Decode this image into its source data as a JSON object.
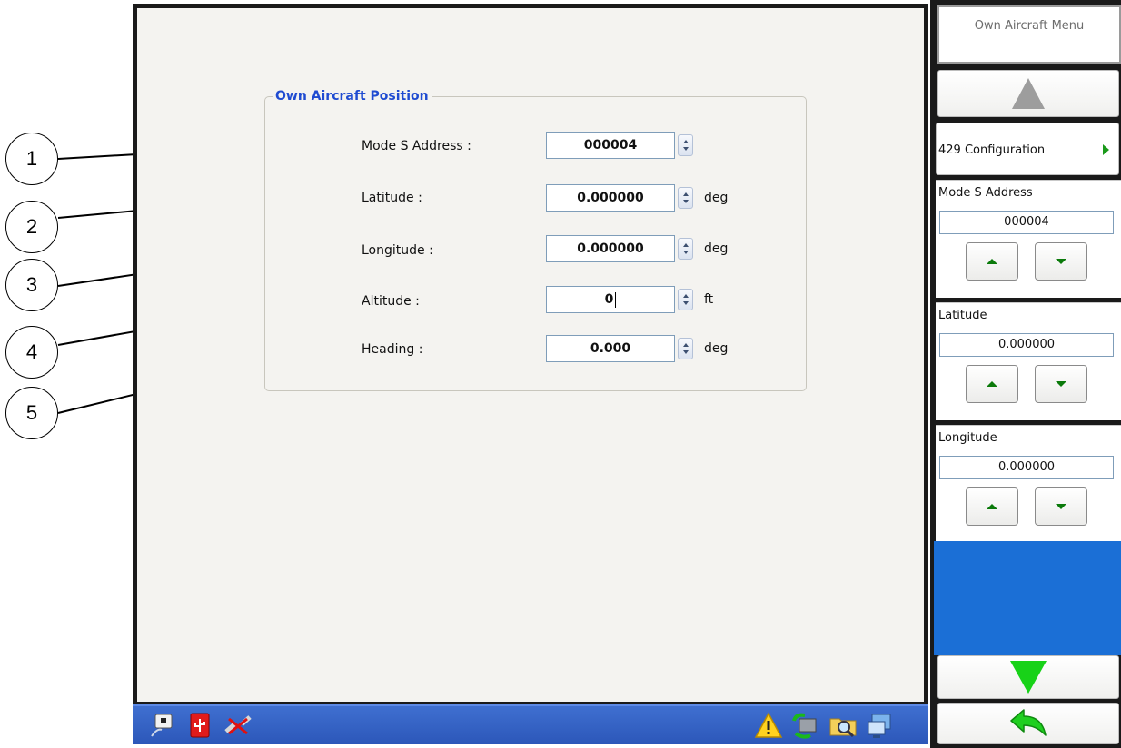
{
  "callouts": [
    "1",
    "2",
    "3",
    "4",
    "5"
  ],
  "group": {
    "title": "Own Aircraft Position"
  },
  "fields": [
    {
      "label": "Mode S Address :",
      "value": "000004",
      "unit": ""
    },
    {
      "label": "Latitude :",
      "value": "0.000000",
      "unit": "deg"
    },
    {
      "label": "Longitude :",
      "value": "0.000000",
      "unit": "deg"
    },
    {
      "label": "Altitude :",
      "value": "0",
      "unit": "ft"
    },
    {
      "label": "Heading :",
      "value": "0.000",
      "unit": "deg"
    }
  ],
  "menu": {
    "title": "Own Aircraft Menu",
    "config_label": "429 Configuration",
    "params": [
      {
        "label": "Mode S Address",
        "value": "000004"
      },
      {
        "label": "Latitude",
        "value": "0.000000"
      },
      {
        "label": "Longitude",
        "value": "0.000000"
      }
    ]
  },
  "colors": {
    "taskbar": "#2c57b9",
    "group_title": "#1f4bd1",
    "menu_blue": "#1b6fd6",
    "green_arrow": "#18d218"
  },
  "taskbar_icons": [
    "network-icon",
    "usb-icon",
    "disconnected-cable-icon",
    "warning-icon",
    "sync-icon",
    "folder-search-icon",
    "remote-display-icon"
  ]
}
